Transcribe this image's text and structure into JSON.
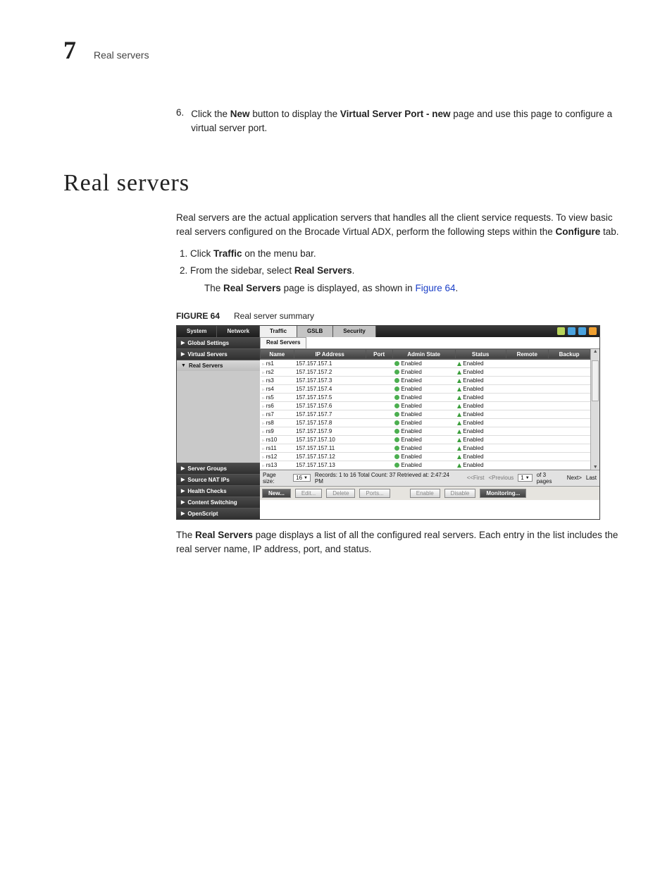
{
  "header": {
    "chapter": "7",
    "title": "Real servers"
  },
  "preStep": {
    "num": "6.",
    "text_a": "Click the ",
    "bold_a": "New",
    "text_b": " button to display the ",
    "bold_b": "Virtual Server Port - new",
    "text_c": " page and use this page to configure a virtual server port."
  },
  "section": {
    "title": "Real servers"
  },
  "intro": {
    "text_a": "Real servers are the actual application servers that handles all the client service requests. To view basic real servers configured on the Brocade Virtual ADX, perform the following steps within the ",
    "bold_a": "Configure",
    "text_b": " tab."
  },
  "steps": {
    "s1": {
      "text_a": "Click ",
      "bold_a": "Traffic",
      "text_b": " on the menu bar."
    },
    "s2": {
      "text_a": "From the sidebar, select ",
      "bold_a": "Real Servers",
      "text_b": ".",
      "sub_a": "The ",
      "sub_bold": "Real Servers",
      "sub_b": " page is displayed, as shown in ",
      "link": "Figure 64",
      "sub_c": "."
    }
  },
  "figure": {
    "label": "FIGURE 64",
    "caption": "Real server summary"
  },
  "scr": {
    "tabs": {
      "system": "System",
      "network": "Network",
      "traffic": "Traffic",
      "gslb": "GSLB",
      "security": "Security"
    },
    "sidebar": {
      "global": "Global Settings",
      "virtual": "Virtual Servers",
      "real": "Real Servers",
      "groups": "Server Groups",
      "nat": "Source NAT IPs",
      "health": "Health Checks",
      "content": "Content Switching",
      "openscript": "OpenScript"
    },
    "mainTab": "Real Servers",
    "headers": {
      "name": "Name",
      "ip": "IP Address",
      "port": "Port",
      "admin": "Admin State",
      "status": "Status",
      "remote": "Remote",
      "backup": "Backup"
    },
    "rows": [
      {
        "name": "rs1",
        "ip": "157.157.157.1",
        "admin": "Enabled",
        "status": "Enabled"
      },
      {
        "name": "rs2",
        "ip": "157.157.157.2",
        "admin": "Enabled",
        "status": "Enabled"
      },
      {
        "name": "rs3",
        "ip": "157.157.157.3",
        "admin": "Enabled",
        "status": "Enabled"
      },
      {
        "name": "rs4",
        "ip": "157.157.157.4",
        "admin": "Enabled",
        "status": "Enabled"
      },
      {
        "name": "rs5",
        "ip": "157.157.157.5",
        "admin": "Enabled",
        "status": "Enabled"
      },
      {
        "name": "rs6",
        "ip": "157.157.157.6",
        "admin": "Enabled",
        "status": "Enabled"
      },
      {
        "name": "rs7",
        "ip": "157.157.157.7",
        "admin": "Enabled",
        "status": "Enabled"
      },
      {
        "name": "rs8",
        "ip": "157.157.157.8",
        "admin": "Enabled",
        "status": "Enabled"
      },
      {
        "name": "rs9",
        "ip": "157.157.157.9",
        "admin": "Enabled",
        "status": "Enabled"
      },
      {
        "name": "rs10",
        "ip": "157.157.157.10",
        "admin": "Enabled",
        "status": "Enabled"
      },
      {
        "name": "rs11",
        "ip": "157.157.157.11",
        "admin": "Enabled",
        "status": "Enabled"
      },
      {
        "name": "rs12",
        "ip": "157.157.157.12",
        "admin": "Enabled",
        "status": "Enabled"
      },
      {
        "name": "rs13",
        "ip": "157.157.157.13",
        "admin": "Enabled",
        "status": "Enabled"
      }
    ],
    "pager": {
      "sizeLabel": "Page size:",
      "sizeVal": "16",
      "records": "Records: 1 to 16  Total Count: 37  Retrieved at: 2:47:24 PM",
      "first": "<<First",
      "prev": "<Previous",
      "pageVal": "1",
      "of": "of 3 pages",
      "next": "Next>",
      "last": "Last"
    },
    "buttons": {
      "new": "New...",
      "edit": "Edit...",
      "delete": "Delete",
      "ports": "Ports...",
      "enable": "Enable",
      "disable": "Disable",
      "monitoring": "Monitoring..."
    }
  },
  "post": {
    "text_a": "The ",
    "bold_a": "Real Servers",
    "text_b": " page displays a list of all the configured real servers. Each entry in the list includes the real server name, IP address, port, and status."
  }
}
